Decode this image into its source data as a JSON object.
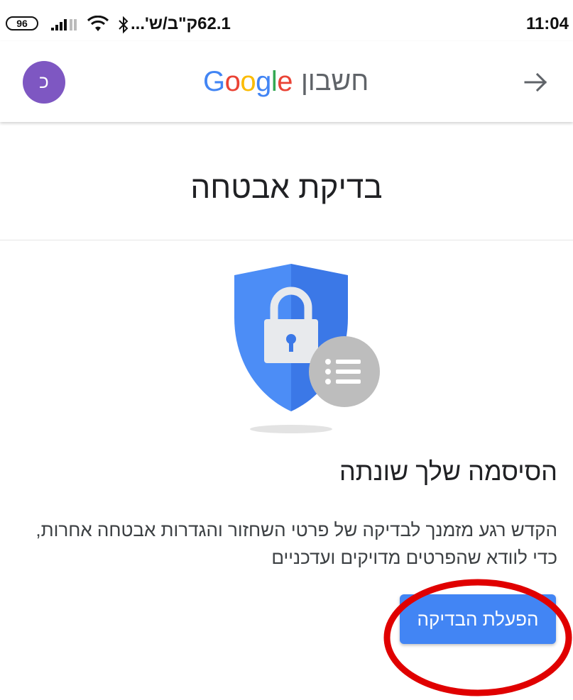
{
  "status_bar": {
    "battery": "96",
    "carrier_text": "62.1ק\"ב/ש'...",
    "time": "11:04",
    "icons": [
      "battery-icon",
      "signal-icon",
      "wifi-icon",
      "bluetooth-icon"
    ]
  },
  "header": {
    "avatar_letter": "כ",
    "logo_text": "Google",
    "brand_word": "חשבון",
    "back_icon": "arrow-right-icon"
  },
  "page": {
    "title": "בדיקת אבטחה"
  },
  "card": {
    "illustration": "shield-lock-list-icon",
    "title": "הסיסמה שלך שונתה",
    "description": "הקדש רגע מזמנך לבדיקה של פרטי השחזור והגדרות אבטחה אחרות, כדי לוודא שהפרטים מדויקים ועדכניים",
    "button_label": "הפעלת הבדיקה"
  },
  "colors": {
    "accent_blue": "#4285f4",
    "avatar_purple": "#7e57c2",
    "highlight_red": "#e00000",
    "google_blue": "#4285F4",
    "google_red": "#EA4335",
    "google_yellow": "#FBBC05",
    "google_green": "#34A853"
  }
}
